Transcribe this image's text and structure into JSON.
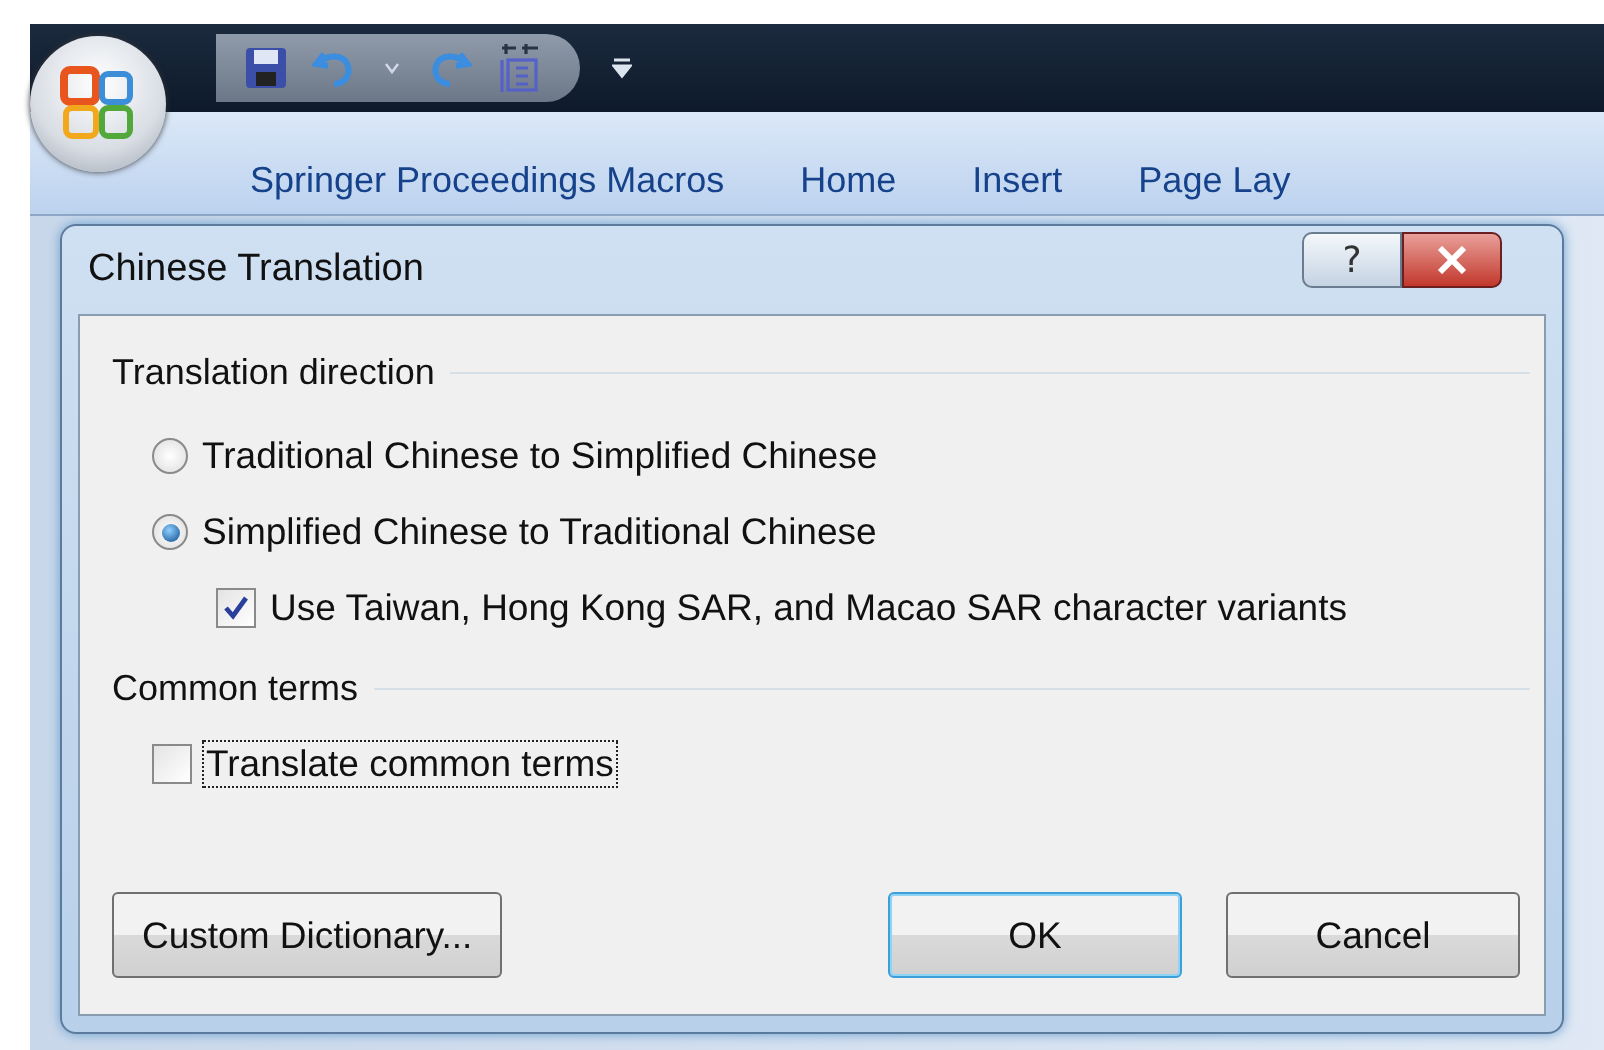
{
  "ribbon_tabs": [
    "Springer Proceedings Macros",
    "Home",
    "Insert",
    "Page Lay"
  ],
  "dialog": {
    "title": "Chinese Translation",
    "help_button": "?",
    "sections": [
      {
        "heading": "Translation direction",
        "options": [
          {
            "kind": "radio",
            "label": "Traditional Chinese to Simplified Chinese",
            "selected": false
          },
          {
            "kind": "radio",
            "label": "Simplified Chinese to Traditional Chinese",
            "selected": true,
            "children": [
              {
                "kind": "checkbox",
                "label": "Use Taiwan, Hong Kong SAR, and Macao SAR character variants",
                "checked": true,
                "focused": false
              }
            ]
          }
        ]
      },
      {
        "heading": "Common terms",
        "options": [
          {
            "kind": "checkbox",
            "label": "Translate common terms",
            "checked": false,
            "focused": true
          }
        ]
      }
    ],
    "buttons": [
      {
        "label": "Custom Dictionary...",
        "default": false
      },
      {
        "label": "OK",
        "default": true
      },
      {
        "label": "Cancel",
        "default": false
      }
    ]
  }
}
